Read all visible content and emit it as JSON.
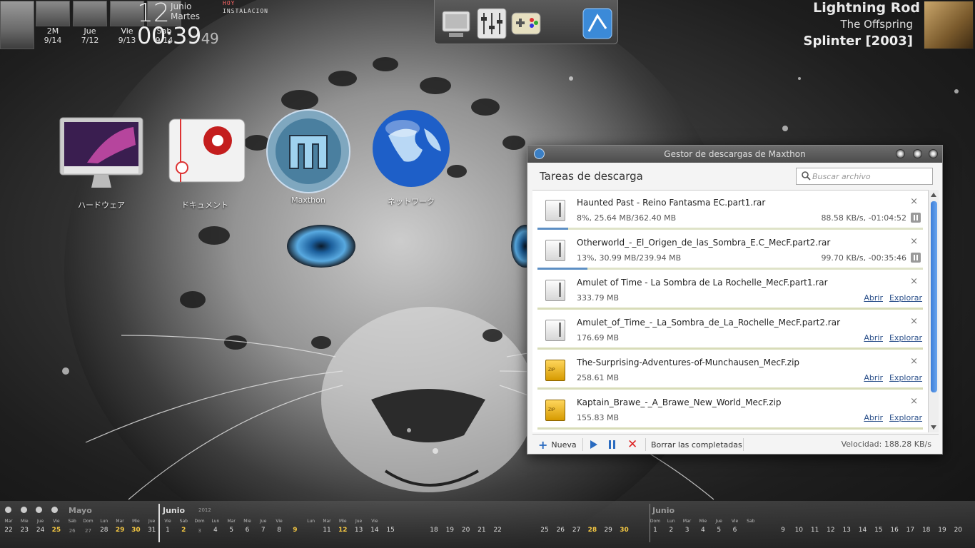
{
  "weather": {
    "days": [
      {
        "day": "2M",
        "date": "9/14"
      },
      {
        "day": "Jue",
        "date": "7/12"
      },
      {
        "day": "Vie",
        "date": "9/13"
      },
      {
        "day": "Sab",
        "date": "9/14"
      }
    ]
  },
  "clock": {
    "day": "12",
    "month": "Junio",
    "weekday": "Martes",
    "time": "00:39",
    "seconds": "49",
    "hoy": "HOY",
    "install": "INSTALACION"
  },
  "now_playing": {
    "song": "Lightning Rod",
    "artist": "The Offspring",
    "album": "Splinter [2003]"
  },
  "desktop_icons": [
    {
      "label": "ハードウェア",
      "icon": "imac-icon"
    },
    {
      "label": "ドキュメント",
      "icon": "documents-icon"
    },
    {
      "label": "Maxthon",
      "icon": "maxthon-icon"
    },
    {
      "label": "ネットワーク",
      "icon": "network-globe-icon"
    }
  ],
  "dock": {
    "items": [
      "monitor-icon",
      "mixer-icon",
      "gamepad-icon",
      "maxthon-cloud-icon"
    ]
  },
  "download_manager": {
    "title": "Gestor de descargas de Maxthon",
    "heading": "Tareas de descarga",
    "search_placeholder": "Buscar archivo",
    "downloads": [
      {
        "name": "Haunted Past - Reino Fantasma EC.part1.rar",
        "size": "8%, 25.64 MB/362.40 MB",
        "speed": "88.58 KB/s, -01:04:52",
        "type": "rar",
        "state": "downloading",
        "progress": 0.08
      },
      {
        "name": "Otherworld_-_El_Origen_de_las_Sombra_E.C_MecF.part2.rar",
        "size": "13%, 30.99 MB/239.94 MB",
        "speed": "99.70 KB/s, -00:35:46",
        "type": "rar",
        "state": "downloading",
        "progress": 0.13
      },
      {
        "name": "Amulet of Time - La Sombra de La Rochelle_MecF.part1.rar",
        "size": "333.79 MB",
        "type": "rar",
        "state": "done"
      },
      {
        "name": "Amulet_of_Time_-_La_Sombra_de_La_Rochelle_MecF.part2.rar",
        "size": "176.69 MB",
        "type": "rar",
        "state": "done"
      },
      {
        "name": "The-Surprising-Adventures-of-Munchausen_MecF.zip",
        "size": "258.61 MB",
        "type": "zip",
        "state": "done"
      },
      {
        "name": "Kaptain_Brawe_-_A_Brawe_New_World_MecF.zip",
        "size": "155.83 MB",
        "type": "zip",
        "state": "done"
      }
    ],
    "open_label": "Abrir",
    "explore_label": "Explorar",
    "new_label": "Nueva",
    "clear_label": "Borrar las completadas",
    "velocity": "Velocidad: 188.28 KB/s",
    "close_glyph": "×"
  },
  "calendar": {
    "months": [
      {
        "name": "Mayo",
        "color": "#999999"
      },
      {
        "name": "Junio",
        "year": "2012",
        "color": "#dddddd"
      },
      {
        "name": "Junio",
        "color": "#999999"
      }
    ],
    "segments": [
      {
        "weekdays": [
          "Mar",
          "Mie",
          "Jue",
          "Vie",
          "Sab",
          "Dom",
          "Lun",
          "Mar",
          "Mie",
          "Jue"
        ],
        "days": [
          "22",
          "23",
          "24",
          "25",
          "26",
          "27",
          "28",
          "29",
          "30",
          "31"
        ],
        "highlight": [
          "25",
          "29",
          "30"
        ],
        "dim": [
          "26",
          "27"
        ]
      },
      {
        "weekdays": [
          "Vie",
          "Sab",
          "Dom",
          "Lun",
          "Mar",
          "Mie",
          "Jue",
          "Vie",
          "",
          "Lun",
          "Mar",
          "Mie",
          "Jue",
          "Vie"
        ],
        "days": [
          "1",
          "2",
          "3",
          "4",
          "5",
          "6",
          "7",
          "8",
          "9",
          "",
          "11",
          "12",
          "13",
          "14",
          "15"
        ],
        "highlight": [
          "2",
          "9",
          "12"
        ],
        "dim": [
          "3"
        ]
      },
      {
        "days": [
          "18",
          "19",
          "20",
          "21",
          "22"
        ]
      },
      {
        "days": [
          "25",
          "26",
          "27",
          "28",
          "29",
          "30"
        ],
        "highlight": [
          "28",
          "30"
        ]
      },
      {
        "weekdays": [
          "Dom",
          "Lun",
          "Mar",
          "Mie",
          "Jue",
          "Vie",
          "Sab"
        ],
        "days": [
          "1",
          "2",
          "3",
          "4",
          "5",
          "6"
        ]
      },
      {
        "days": [
          "9",
          "10",
          "11",
          "12",
          "13",
          "14",
          "15",
          "16",
          "17",
          "18",
          "19",
          "20"
        ],
        "highlight": []
      }
    ]
  }
}
